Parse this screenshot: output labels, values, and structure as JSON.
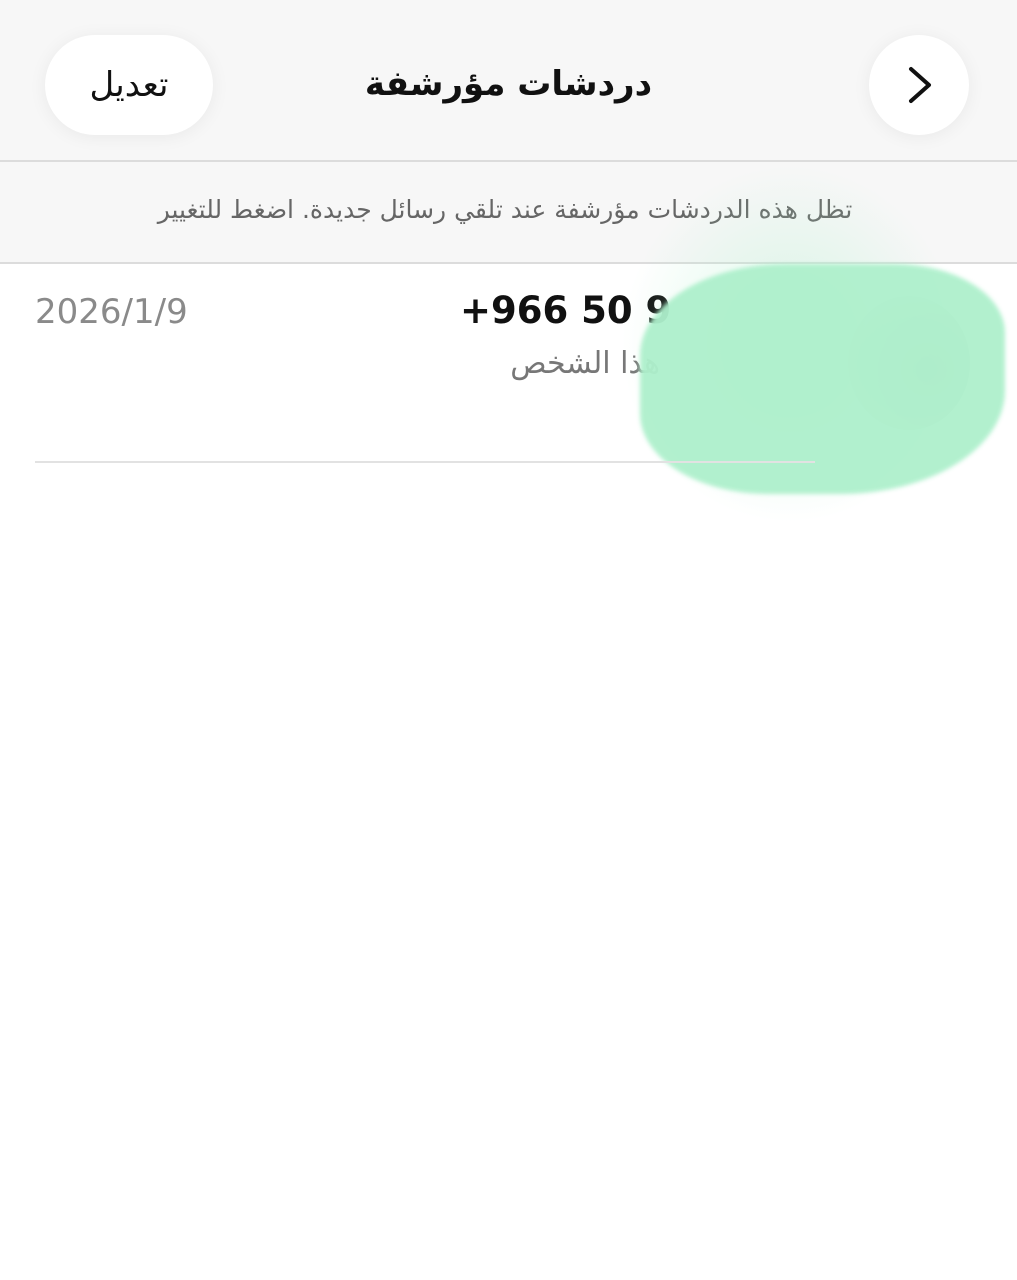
{
  "header": {
    "edit_label": "تعديل",
    "title": "دردشات مؤرشفة",
    "back_icon": "chevron-right-icon"
  },
  "info": {
    "text": "تظل هذه الدردشات مؤرشفة عند تلقي رسائل جديدة. اضغط للتغيير"
  },
  "chats": [
    {
      "name": "+966 50 9",
      "preview": "هذا الشخص",
      "date": "2026/1/9"
    }
  ],
  "colors": {
    "redaction": "#aef0cc",
    "header_bg": "#f7f7f7"
  }
}
